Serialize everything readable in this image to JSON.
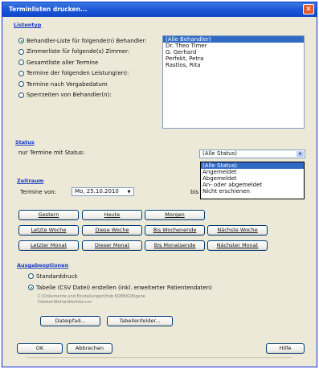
{
  "window": {
    "title": "Terminlisten drucken..."
  },
  "listentyp": {
    "label": "Listentyp",
    "options": [
      {
        "label": "Behandler-Liste für folgende(n) Behandler:",
        "checked": true
      },
      {
        "label": "Zimmerliste für folgende(s) Zimmer:",
        "checked": false
      },
      {
        "label": "Gesamtliste aller Termine",
        "checked": false
      },
      {
        "label": "Termine der folgenden Leistung(en):",
        "checked": false
      },
      {
        "label": "Termine nach Vergabedatum",
        "checked": false
      },
      {
        "label": "Sperrzeiten von Behandler(n):",
        "checked": false
      }
    ],
    "list_items": [
      "(Alle Behandler)",
      "Dr. Theo Timer",
      "G. Gerhard",
      "Perfekt, Petra",
      "Rastlos, Rita"
    ]
  },
  "status": {
    "label": "Status",
    "filter_label": "nur Termine mit Status:",
    "selected": "(Alle Status)",
    "options": [
      "(Alle Status)",
      "Angemeldet",
      "Abgemeldet",
      "An- oder abgemeldet",
      "Nicht erschienen"
    ]
  },
  "zeitraum": {
    "label": "Zeitraum",
    "from_label": "Termine von:",
    "from_value": "Mo, 25.10.2010",
    "to_label": "bis",
    "buttons_row1": [
      "Gestern",
      "Heute",
      "Morgen"
    ],
    "buttons_row2": [
      "Letzte Woche",
      "Diese Woche",
      "Bis Wochenende",
      "Nächste Woche"
    ],
    "buttons_row3": [
      "Letzter Monat",
      "Dieser Monat",
      "Bis Monatsende",
      "Nächster Monat"
    ]
  },
  "ausgabe": {
    "label": "Ausgabeoptionen",
    "options": [
      {
        "label": "Standarddruck",
        "checked": false
      },
      {
        "label": "Tabelle (CSV Datei) erstellen (inkl. erweiterter Patientendaten)",
        "checked": true
      }
    ],
    "path_line1": "C:\\Dokumente und Einstellungen\\Hub KOENIG\\Eigene",
    "path_line2": "Dateien\\Behandlerliste.csv",
    "dateipfad_button": "Dateipfad...",
    "tabellenfelder_button": "Tabellenfelder..."
  },
  "footer": {
    "ok": "OK",
    "cancel": "Abbrechen",
    "help": "Hilfe"
  }
}
